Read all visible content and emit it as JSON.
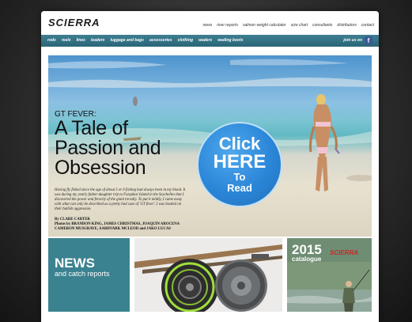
{
  "header": {
    "logo": "SCIERRA",
    "top_nav": [
      "news",
      "river reports",
      "salmon weight calculator",
      "size chart",
      "consultants",
      "distributors",
      "contact"
    ]
  },
  "nav": {
    "items": [
      "rods",
      "reels",
      "lines",
      "leaders",
      "luggage and bags",
      "accessories",
      "clothing",
      "waders",
      "wading boots"
    ],
    "join_label": "join us on",
    "social_icon": "facebook-icon"
  },
  "hero": {
    "kicker": "GT FEVER:",
    "headline_lines": [
      "A Tale of",
      "Passion and",
      "Obsession"
    ],
    "intro": "Having fly fished since the age of about 5 or 6 fishing had always been in my blood. It was during my yearly father-daughter trip to Farquhar Island in the Seychelles that I discovered the power and ferocity of the giant trevally. To put it mildly, I came away with what can only be described as a pretty bad case of 'GT fever', I was hooked on their bullish aggression.",
    "byline": "By CLARE CARTER",
    "credits_lines": [
      "Photos by BRANDON KING, JAMES CHRISTMAS, JOAQUIN AROCENA",
      "CAMERON MUSGRAVE, AARDVARK MCLEOD and JAKO LUCAS"
    ],
    "cta_lines": [
      "Click",
      "HERE",
      "To",
      "Read"
    ]
  },
  "tiles": {
    "news_title": "NEWS",
    "news_subtitle": "and catch reports",
    "catalogue_year": "2015",
    "catalogue_word": "catalogue",
    "catalogue_brand": "SCIERRA"
  },
  "colors": {
    "accent_teal": "#2f6f82",
    "news_tile": "#3b8290",
    "cta_blue": "#2b86d8",
    "facebook": "#3b5998"
  }
}
